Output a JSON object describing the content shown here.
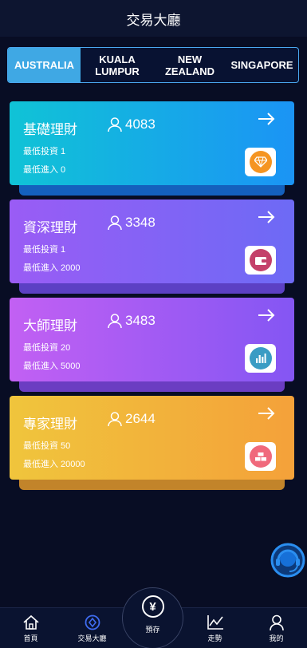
{
  "header": {
    "title": "交易大廳"
  },
  "tabs": [
    {
      "label": "AUSTRALIA",
      "active": true
    },
    {
      "label": "KUALA\nLUMPUR",
      "active": false
    },
    {
      "label": "NEW\nZEALAND",
      "active": false
    },
    {
      "label": "SINGAPORE",
      "active": false
    }
  ],
  "cards": [
    {
      "title": "基礎理財",
      "count": "4083",
      "min_invest": "最低投資 1",
      "min_entry": "最低進入 0",
      "icon": "diamond-icon",
      "gradient": [
        "#10c3d6",
        "#1b94f5"
      ],
      "icon_color": "#f59522"
    },
    {
      "title": "資深理財",
      "count": "3348",
      "min_invest": "最低投資 1",
      "min_entry": "最低進入 2000",
      "icon": "wallet-icon",
      "gradient": [
        "#9a5cf5",
        "#6d6af5"
      ],
      "icon_color": "#c4406a"
    },
    {
      "title": "大師理財",
      "count": "3483",
      "min_invest": "最低投資 20",
      "min_entry": "最低進入 5000",
      "icon": "chart-icon",
      "gradient": [
        "#c260f3",
        "#8456f3"
      ],
      "icon_color": "#3a9cc4"
    },
    {
      "title": "專家理財",
      "count": "2644",
      "min_invest": "最低投資 50",
      "min_entry": "最低進入 20000",
      "icon": "gold-bars-icon",
      "gradient": [
        "#f0c53c",
        "#f4a13a"
      ],
      "icon_color": "#f0697c"
    }
  ],
  "bottom_nav": {
    "home": "首頁",
    "trading": "交易大廳",
    "deposit": "預存",
    "trend": "走勢",
    "mine": "我的"
  }
}
